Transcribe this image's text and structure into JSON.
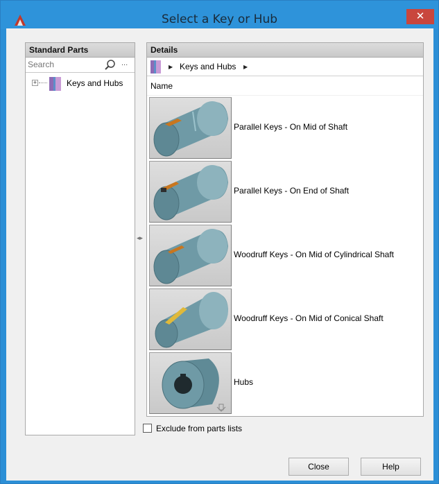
{
  "window": {
    "title": "Select a Key or Hub",
    "close_glyph": "✕"
  },
  "left_panel": {
    "header": "Standard Parts",
    "search_placeholder": "Search",
    "more_glyph": "...",
    "tree": [
      {
        "label": "Keys and Hubs",
        "icon": "book-icon",
        "expanded": false
      }
    ]
  },
  "right_panel": {
    "header": "Details",
    "breadcrumb": {
      "label": "Keys and Hubs"
    },
    "column_header": "Name",
    "items": [
      {
        "label": "Parallel Keys - On Mid of Shaft",
        "icon": "shaft-mid-key"
      },
      {
        "label": "Parallel Keys - On End of Shaft",
        "icon": "shaft-end-key"
      },
      {
        "label": "Woodruff Keys - On Mid of Cylindrical Shaft",
        "icon": "woodruff-cylindrical"
      },
      {
        "label": "Woodruff Keys - On Mid of Conical Shaft",
        "icon": "woodruff-conical"
      },
      {
        "label": "Hubs",
        "icon": "hub"
      }
    ]
  },
  "exclude_checkbox": {
    "label": "Exclude from parts lists",
    "checked": false
  },
  "buttons": {
    "close": "Close",
    "help": "Help"
  },
  "colors": {
    "title_bar": "#2e93da",
    "close_button": "#c9463d",
    "panel_header": "#cfcfcf"
  }
}
